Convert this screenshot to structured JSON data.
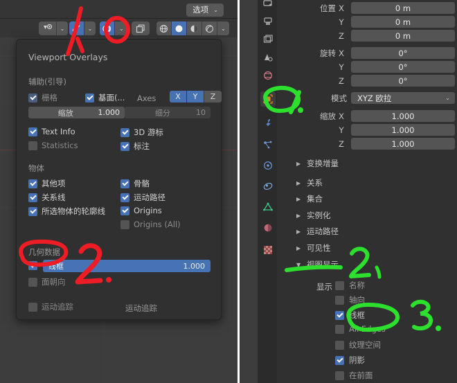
{
  "left_panel": {
    "header": {
      "options_button": "选项",
      "chevron": "⌄",
      "icons": [
        {
          "name": "object-types-visibility-icon"
        },
        {
          "name": "gizmo-icon"
        },
        {
          "name": "overlays-icon"
        },
        {
          "name": "xray-toggle-icon"
        },
        {
          "name": "shading-wireframe-icon"
        },
        {
          "name": "shading-solid-icon"
        },
        {
          "name": "shading-material-icon"
        },
        {
          "name": "shading-rendered-icon"
        }
      ]
    },
    "popover": {
      "title": "Viewport Overlays",
      "sections": [
        {
          "label": "辅助(引导)",
          "rows": [
            {
              "type": "checkbox",
              "label": "栅格",
              "checked": true,
              "dim": true
            },
            {
              "type": "checkbox",
              "label": "基面(...",
              "checked": true
            },
            {
              "type": "axes",
              "label": "Axes",
              "buttons": [
                {
                  "label": "X",
                  "on": true
                },
                {
                  "label": "Y",
                  "on": true
                },
                {
                  "label": "Z",
                  "on": false
                }
              ]
            },
            {
              "type": "field",
              "label": "缩放",
              "value": "1.000",
              "muted": false
            },
            {
              "type": "field",
              "label": "细分",
              "value": "10",
              "muted": true
            },
            {
              "type": "checkbox",
              "label": "Text Info",
              "checked": true
            },
            {
              "type": "checkbox",
              "label": "3D 游标",
              "checked": true
            },
            {
              "type": "checkbox",
              "label": "Statistics",
              "checked": false
            },
            {
              "type": "checkbox",
              "label": "标注",
              "checked": true
            }
          ]
        },
        {
          "label": "物体",
          "rows": [
            {
              "type": "checkbox",
              "label": "其他项",
              "checked": true
            },
            {
              "type": "checkbox",
              "label": "骨骼",
              "checked": true
            },
            {
              "type": "checkbox",
              "label": "关系线",
              "checked": true
            },
            {
              "type": "checkbox",
              "label": "运动路径",
              "checked": true
            },
            {
              "type": "checkbox",
              "label": "所选物体的轮廓线",
              "checked": true
            },
            {
              "type": "checkbox",
              "label": "Origins",
              "checked": true
            },
            {
              "type": "checkbox",
              "label": "Origins (All)",
              "checked": false,
              "dim": true
            }
          ]
        },
        {
          "label": "几何数据",
          "rows": [
            {
              "type": "slider",
              "label": "线框",
              "value": "1.000",
              "checked": true
            },
            {
              "type": "checkbox",
              "label": "面朝向",
              "checked": false,
              "dim": true
            },
            {
              "type": "checkbox",
              "label": "运动追踪",
              "checked": false,
              "dim": true
            },
            {
              "type": "text",
              "label": "运动追踪"
            }
          ]
        }
      ]
    },
    "collapse_arrow": "‹"
  },
  "right_panel": {
    "tabs": [
      {
        "name": "tool-tab-icon",
        "active": false
      },
      {
        "name": "render-tab-icon",
        "active": false
      },
      {
        "name": "output-tab-icon",
        "active": false
      },
      {
        "name": "view-layer-tab-icon",
        "active": false
      },
      {
        "name": "scene-tab-icon",
        "active": false
      },
      {
        "name": "world-tab-icon",
        "active": false
      },
      {
        "name": "object-tab-icon",
        "active": true
      },
      {
        "name": "modifiers-tab-icon",
        "active": false
      },
      {
        "name": "particles-tab-icon",
        "active": false
      },
      {
        "name": "physics-tab-icon",
        "active": false
      },
      {
        "name": "constraints-tab-icon",
        "active": false
      },
      {
        "name": "object-data-tab-icon",
        "active": false
      },
      {
        "name": "material-tab-icon",
        "active": false
      },
      {
        "name": "texture-tab-icon",
        "active": false
      }
    ],
    "transform": {
      "location": {
        "label": "位置",
        "axes": [
          "X",
          "Y",
          "Z"
        ],
        "values": [
          "0 m",
          "0 m",
          "0 m"
        ]
      },
      "rotation": {
        "label": "旋转",
        "axes": [
          "X",
          "Y",
          "Z"
        ],
        "values": [
          "0°",
          "0°",
          "0°"
        ]
      },
      "mode": {
        "label": "模式",
        "value": "XYZ 欧拉",
        "chevron": "⌄"
      },
      "scale": {
        "label": "缩放",
        "axes": [
          "X",
          "Y",
          "Z"
        ],
        "values": [
          "1.000",
          "1.000",
          "1.000"
        ]
      }
    },
    "panels": [
      {
        "label": "变换增量",
        "open": false
      },
      {
        "label": "关系",
        "open": false
      },
      {
        "label": "集合",
        "open": false
      },
      {
        "label": "实例化",
        "open": false
      },
      {
        "label": "运动路径",
        "open": false
      },
      {
        "label": "可见性",
        "open": false
      },
      {
        "label": "视图显示",
        "open": true
      }
    ],
    "viewport_display": {
      "show_label": "显示",
      "options": [
        {
          "label": "名称",
          "checked": false
        },
        {
          "label": "轴向",
          "checked": false
        },
        {
          "label": "线框",
          "checked": true
        },
        {
          "label": "All Edges",
          "checked": false
        },
        {
          "label": "纹理空间",
          "checked": false
        },
        {
          "label": "阴影",
          "checked": true
        },
        {
          "label": "在前面",
          "checked": false
        }
      ]
    }
  },
  "annotations": {
    "red_color": "#ee1c25",
    "green_color": "#2ee02e",
    "marks": [
      {
        "name": "red-stroke-slash",
        "kind": "stroke",
        "color": "#ee1c25"
      },
      {
        "name": "red-circle-overlays-dropdown",
        "kind": "circle",
        "color": "#ee1c25"
      },
      {
        "name": "red-circle-wireframe-checkbox",
        "kind": "circle",
        "color": "#ee1c25"
      },
      {
        "name": "red-number-2",
        "kind": "text",
        "text": "2.",
        "color": "#ee1c25"
      },
      {
        "name": "green-circle-object-tab",
        "kind": "circle",
        "color": "#2ee02e"
      },
      {
        "name": "green-number-1",
        "kind": "text",
        "text": "1.",
        "color": "#2ee02e"
      },
      {
        "name": "green-underline-viewport-display",
        "kind": "stroke",
        "color": "#2ee02e"
      },
      {
        "name": "green-number-2",
        "kind": "text",
        "text": "2、",
        "color": "#2ee02e"
      },
      {
        "name": "green-circle-wireframe-option",
        "kind": "circle",
        "color": "#2ee02e"
      },
      {
        "name": "green-number-3",
        "kind": "text",
        "text": "3.",
        "color": "#2ee02e"
      }
    ]
  }
}
